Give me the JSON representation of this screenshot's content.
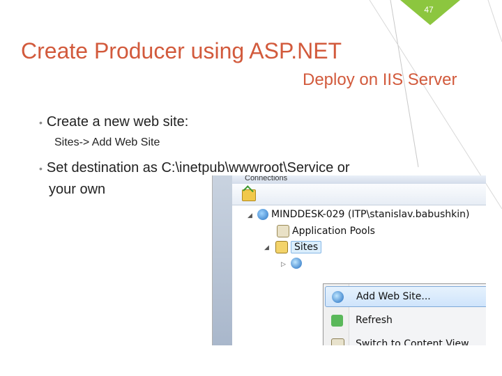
{
  "slide": {
    "number": "47",
    "title": "Create Producer using ASP.NET",
    "subtitle": "Deploy on IIS Server",
    "bullets": [
      {
        "text": "Create a new web site:"
      },
      {
        "text": "Set destination as C:\\inetpub\\wwwroot\\Service or",
        "continuation": "your own"
      }
    ],
    "sub_bullet": "Sites-> Add Web Site"
  },
  "colors": {
    "title": "#d25a3c",
    "accent_triangle": "#8cc63f"
  },
  "iis": {
    "header": "Connections",
    "tree": {
      "server": "MINDDESK-029 (ITP\\stanislav.babushkin)",
      "app_pools": "Application Pools",
      "sites": "Sites"
    },
    "context_menu": [
      {
        "label": "Add Web Site...",
        "icon": "globe-add-icon",
        "highlighted": true
      },
      {
        "label": "Refresh",
        "icon": "refresh-icon"
      },
      {
        "label": "Switch to Content View",
        "icon": "content-view-icon"
      }
    ]
  }
}
